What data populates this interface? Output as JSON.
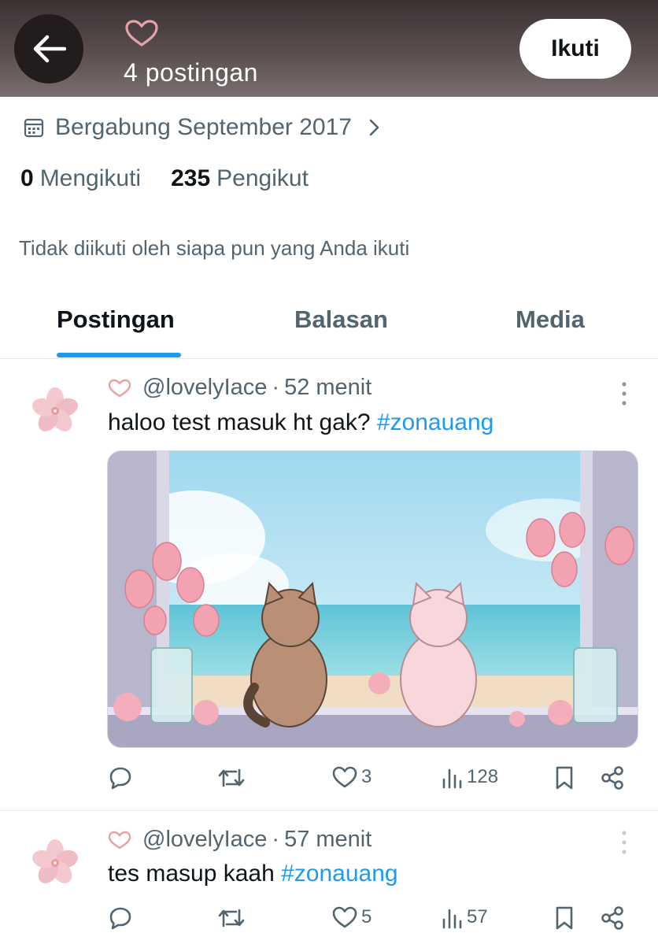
{
  "header": {
    "back_icon": "arrow-left-icon",
    "profile_icon": "heart-outline-icon",
    "posts_count_label": "4 postingan",
    "follow_label": "Ikuti"
  },
  "profile": {
    "joined_icon": "calendar-icon",
    "joined_label": "Bergabung September 2017",
    "following_count": "0",
    "following_label": "Mengikuti",
    "followers_count": "235",
    "followers_label": "Pengikut",
    "not_followed_text": "Tidak diikuti oleh siapa pun yang Anda ikuti"
  },
  "tabs": [
    {
      "label": "Postingan",
      "active": true
    },
    {
      "label": "Balasan",
      "active": false
    },
    {
      "label": "Media",
      "active": false
    }
  ],
  "posts": [
    {
      "handle": "@lovelyIace",
      "separator": "·",
      "time": "52 menit",
      "text": "haloo test masuk ht gak? ",
      "hashtag": "#zonauang",
      "has_media": true,
      "replies": "",
      "reposts": "",
      "likes": "3",
      "views": "128"
    },
    {
      "handle": "@lovelyIace",
      "separator": "·",
      "time": "57 menit",
      "text": "tes masup kaah ",
      "hashtag": "#zonauang",
      "has_media": false,
      "replies": "",
      "reposts": "",
      "likes": "5",
      "views": "57"
    }
  ],
  "colors": {
    "accent": "#1d9bf0",
    "secondary_text": "#536471",
    "heart_pink": "#e8a0a8",
    "header_bg": "#5a4e4f"
  }
}
